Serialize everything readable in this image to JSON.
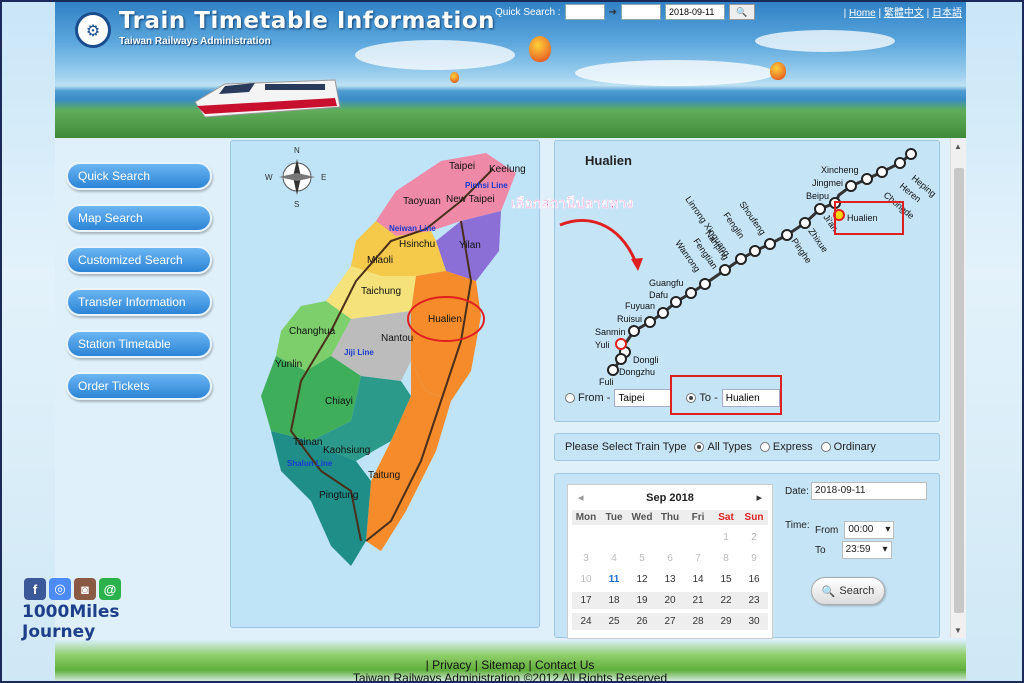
{
  "header": {
    "logo_glyph": "⚙",
    "title": "Train Timetable Information",
    "subtitle": "Taiwan Railways Administration",
    "quick_search_label": "Quick Search :",
    "quick_search_from": "",
    "quick_search_to": "",
    "quick_search_date": "2018-09-11",
    "quick_search_btn": "🔍",
    "links": [
      "Home",
      "繁體中文",
      "日本語"
    ]
  },
  "nav": {
    "items": [
      "Quick Search",
      "Map Search",
      "Customized Search",
      "Transfer Information",
      "Station Timetable",
      "Order Tickets"
    ]
  },
  "map": {
    "compass": {
      "n": "N",
      "s": "S",
      "e": "E",
      "w": "W"
    },
    "regions": [
      "Keelung",
      "Taipei",
      "New Taipei",
      "Taoyuan",
      "Hsinchu",
      "Yilan",
      "Miaoli",
      "Taichung",
      "Hualien",
      "Nantou",
      "Changhua",
      "Yunlin",
      "Chiayi",
      "Tainan",
      "Kaohsiung",
      "Taitung",
      "Pingtung"
    ],
    "lines": [
      "Pinhsi Line",
      "Neiwan Line",
      "Jiji Line",
      "Shalun Line"
    ]
  },
  "line_panel": {
    "title": "Hualien",
    "annotation_th": "เลือกสถานีปลายทาง",
    "stations_upper": [
      "Heping",
      "Heren",
      "Chongde",
      "Xincheng",
      "Jingmei",
      "Beipu",
      "Hualien"
    ],
    "stations_diag": [
      "Ji'an",
      "Zhixue",
      "Pinghe",
      "Shoufeng",
      "Fenglin",
      "Nanping",
      "Linrong Xinguang",
      "Wanrong",
      "Fengtian"
    ],
    "stations_lower": [
      "Guangfu",
      "Dafu",
      "Fuyuan",
      "Ruisui",
      "Sanmin",
      "Yuli",
      "Dongli",
      "Dongzhu",
      "Fuli"
    ],
    "from_label": "From -",
    "from_value": "Taipei",
    "to_label": "To -",
    "to_value": "Hualien"
  },
  "train_type": {
    "label": "Please Select Train Type",
    "options": [
      "All Types",
      "Express",
      "Ordinary"
    ],
    "selected": "All Types"
  },
  "calendar": {
    "month": "Sep 2018",
    "prev": "◂",
    "next": "▸",
    "weekdays": [
      "Mon",
      "Tue",
      "Wed",
      "Thu",
      "Fri",
      "Sat",
      "Sun"
    ],
    "rows": [
      [
        "",
        "",
        "",
        "",
        "",
        "1",
        "2"
      ],
      [
        "3",
        "4",
        "5",
        "6",
        "7",
        "8",
        "9"
      ],
      [
        "10",
        "11",
        "12",
        "13",
        "14",
        "15",
        "16"
      ],
      [
        "17",
        "18",
        "19",
        "20",
        "21",
        "22",
        "23"
      ],
      [
        "24",
        "25",
        "26",
        "27",
        "28",
        "29",
        "30"
      ]
    ],
    "today": "11"
  },
  "date_form": {
    "date_label": "Date:",
    "date_value": "2018-09-11",
    "time_label": "Time:",
    "from_label": "From",
    "from_value": "00:00",
    "to_label": "To",
    "to_value": "23:59",
    "search_label": "Search"
  },
  "footer": {
    "links_text": "| Privacy | Sitemap | Contact Us",
    "copyright": "Taiwan Railways Administration ©2012 All Rights Reserved"
  },
  "watermark": {
    "line1": "1000Miles",
    "line2": "Journey"
  },
  "colors": {
    "nav_button": "#2c84d6",
    "highlight": "#e02020",
    "annotation": "#e0109a"
  }
}
